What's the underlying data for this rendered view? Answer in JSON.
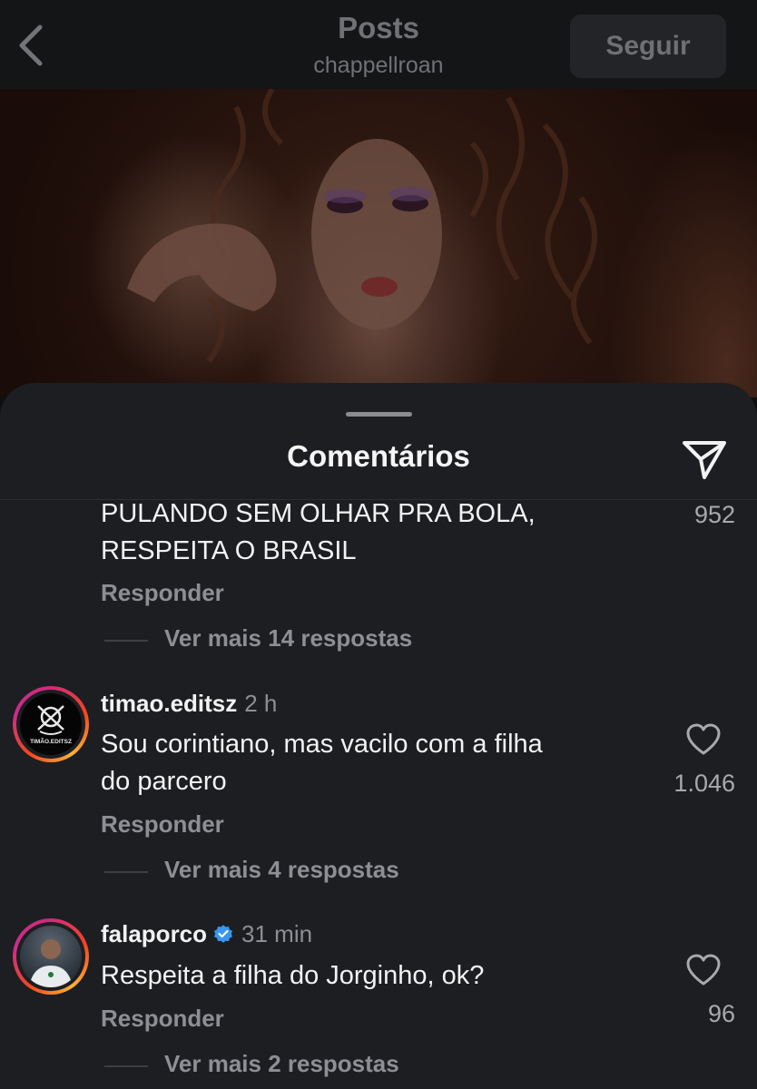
{
  "header": {
    "title": "Posts",
    "subtitle": "chappellroan",
    "follow_label": "Seguir",
    "back_icon": "chevron-left-icon"
  },
  "sheet": {
    "title": "Comentários",
    "share_icon": "paper-plane-icon"
  },
  "comments": [
    {
      "text_lines": [
        "PULANDO SEM OLHAR PRA BOLA,",
        "RESPEITA O BRASIL"
      ],
      "likes": "952",
      "reply_label": "Responder",
      "more_replies": "Ver mais 14 respostas"
    },
    {
      "username": "timao.editsz",
      "time": "2 h",
      "avatar_text": "TIMÃO.EDITSZ",
      "text_lines": [
        "Sou corintiano, mas vacilo com a filha",
        "do parcero"
      ],
      "likes": "1.046",
      "reply_label": "Responder",
      "more_replies": "Ver mais 4 respostas"
    },
    {
      "username": "falaporco",
      "verified": true,
      "time": "31 min",
      "text_lines": [
        "Respeita a filha do Jorginho, ok?"
      ],
      "likes": "96",
      "reply_label": "Responder",
      "more_replies": "Ver mais 2 respostas"
    }
  ],
  "colors": {
    "sheet_bg": "#1c1e21",
    "muted_text": "#8d8f94",
    "verified_blue": "#3897f0",
    "story_ring": "#d3297a"
  }
}
